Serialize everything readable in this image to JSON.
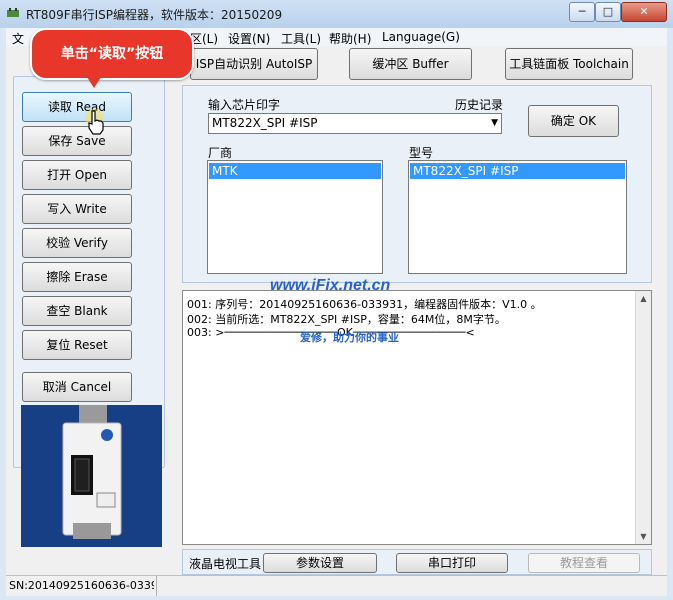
{
  "window": {
    "title": "RT809F串行ISP编程器，软件版本：20150209",
    "min_label": "─",
    "max_label": "□",
    "close_label": "✕"
  },
  "menu": {
    "file_partial": "文",
    "partial_item": "区(L)",
    "settings": "设置(N)",
    "tools": "工具(L)",
    "help": "帮助(H)",
    "language": "Language(G)"
  },
  "toolbar": {
    "isp_auto": "ISP自动识别 AutoISP",
    "buffer": "缓冲区 Buffer",
    "toolchain": "工具链面板 Toolchain"
  },
  "side_buttons": {
    "read": "读取 Read",
    "save": "保存 Save",
    "open": "打开 Open",
    "write": "写入 Write",
    "verify": "校验 Verify",
    "erase": "擦除 Erase",
    "blank": "查空 Blank",
    "reset": "复位 Reset",
    "cancel": "取消 Cancel"
  },
  "chip": {
    "input_label": "输入芯片印字",
    "history_label": "历史记录",
    "combo_value": "MT822X_SPI #ISP",
    "ok_button": "确定 OK",
    "vendor_label": "厂商",
    "model_label": "型号",
    "vendors": [
      "MTK"
    ],
    "models": [
      "MT822X_SPI #ISP"
    ]
  },
  "log": {
    "lines": [
      "001: 序列号：20140925160636-033931，编程器固件版本：V1.0 。",
      "002: 当前所选：MT822X_SPI #ISP，容量：64M位，8M字节。",
      "003: >─────────────────OK─────────────────<"
    ]
  },
  "bottom": {
    "lcd_tools": "液晶电视工具",
    "params": "参数设置",
    "serial_print": "串口打印",
    "tutorial": "教程查看"
  },
  "status": {
    "sn": "SN:20140925160636-0339"
  },
  "overlay": {
    "callout": "单击“读取”按钮",
    "watermark": "www.iFix.net.cn",
    "watermark_sub": "爱修，助力你的事业"
  },
  "colors": {
    "accent": "#3399ff",
    "callout": "#e8362a",
    "titlebar": "#b9d1ec"
  }
}
